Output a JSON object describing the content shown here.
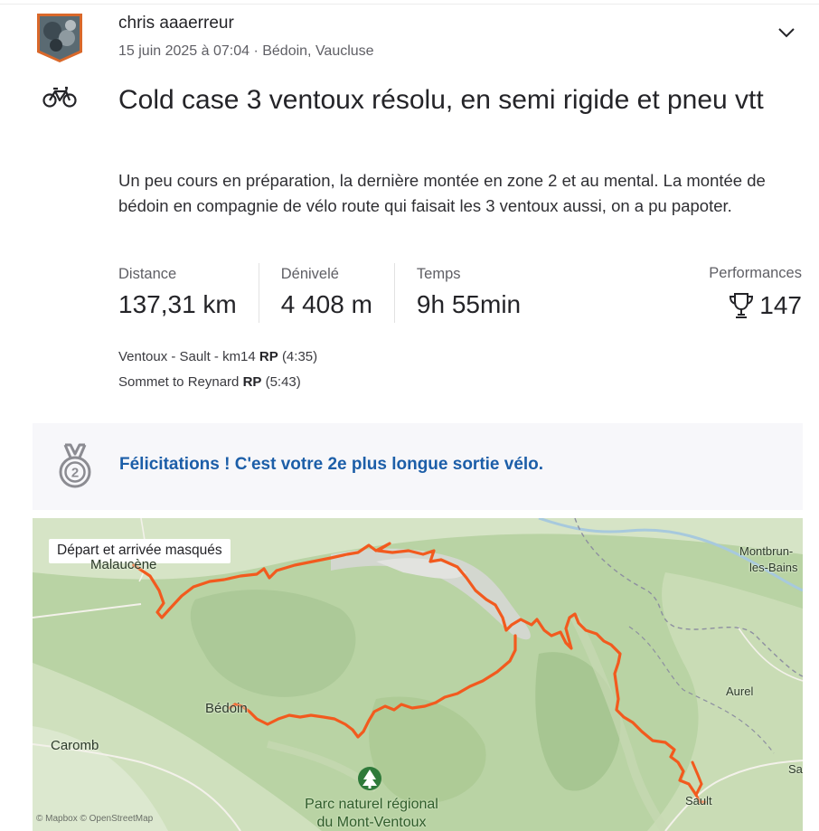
{
  "activity": {
    "athlete_name": "chris aaaerreur",
    "date_location": "15 juin 2025 à 07:04 · Bédoin, Vaucluse",
    "sport_icon": "bike-icon",
    "title": "Cold case 3 ventoux résolu, en semi rigide et pneu vtt",
    "description": "Un peu cours en préparation, la dernière montée en zone 2 et au mental. La montée de bédoin en compagnie de vélo route qui faisait les 3 ventoux aussi, on a pu papoter."
  },
  "stats": [
    {
      "label": "Distance",
      "value": "137,31 km"
    },
    {
      "label": "Dénivelé",
      "value": "4 408 m"
    },
    {
      "label": "Temps",
      "value": "9h 55min"
    }
  ],
  "performances": {
    "label": "Performances",
    "icon": "trophy-icon",
    "value": "147"
  },
  "segments": [
    {
      "name": "Ventoux - Sault - km14",
      "badge": "RP",
      "time": "(4:35)"
    },
    {
      "name": "Sommet to Reynard",
      "badge": "RP",
      "time": "(5:43)"
    }
  ],
  "achievement": {
    "icon": "medal-2-icon",
    "text": "Félicitations ! C'est votre 2e plus longue sortie vélo."
  },
  "map": {
    "badge": "Départ et arrivée masqués",
    "places": {
      "malaucene": "Malaucène",
      "montbrun": "Montbrun-",
      "montbrun2": "les-Bains",
      "bedoin": "Bédoin",
      "aurel": "Aurel",
      "caromb": "Caromb",
      "sault": "Sault",
      "sa": "Sa"
    },
    "park_line1": "Parc naturel régional",
    "park_line2": "du Mont-Ventoux",
    "attribution": "© Mapbox © OpenStreetMap",
    "route_color": "#f25a1e"
  },
  "colors": {
    "accent_link": "#1c5ea8",
    "route": "#f25a1e"
  }
}
